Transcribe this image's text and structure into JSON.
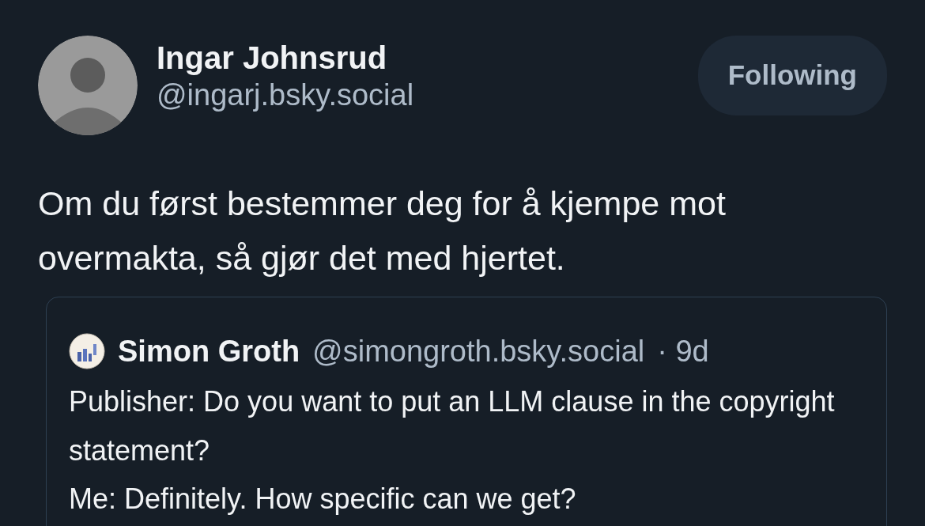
{
  "post": {
    "author": {
      "name": "Ingar Johnsrud",
      "handle": "@ingarj.bsky.social"
    },
    "follow_button": {
      "label": "Following",
      "following": true
    },
    "text": "Om du først bestemmer deg for å kjempe mot overmakta, så gjør det med hjertet.",
    "quote": {
      "author": {
        "name": "Simon Groth",
        "handle": "@simongroth.bsky.social"
      },
      "time": "· 9d",
      "paragraphs": [
        "Publisher: Do you want to put an LLM clause in the copyright statement?",
        "Me: Definitely. How specific can we get?"
      ]
    }
  }
}
